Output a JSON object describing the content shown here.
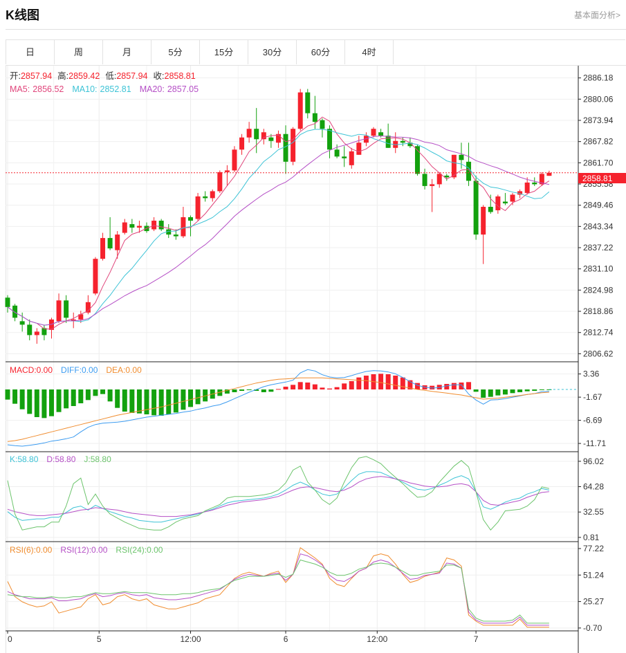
{
  "header": {
    "title": "K线图",
    "link": "基本面分析>"
  },
  "tabs": [
    "日",
    "周",
    "月",
    "5分",
    "15分",
    "30分",
    "60分",
    "4时"
  ],
  "ohlc": {
    "open_label": "开:",
    "open": "2857.94",
    "high_label": "高:",
    "high": "2859.42",
    "low_label": "低:",
    "low": "2857.94",
    "close_label": "收:",
    "close": "2858.81"
  },
  "ma": {
    "ma5_label": "MA5:",
    "ma5": "2856.52",
    "ma10_label": "MA10:",
    "ma10": "2852.81",
    "ma20_label": "MA20:",
    "ma20": "2857.05"
  },
  "macd_legend": {
    "macd": "MACD:0.00",
    "diff": "DIFF:0.00",
    "dea": "DEA:0.00"
  },
  "kdj_legend": {
    "k": "K:58.80",
    "d": "D:58.80",
    "j": "J:58.80"
  },
  "rsi_legend": {
    "r6": "RSI(6):0.00",
    "r12": "RSI(12):0.00",
    "r24": "RSI(24):0.00"
  },
  "current_price": "2858.81",
  "colors": {
    "up": "#f5222d",
    "down": "#13a10e",
    "ma5": "#e0457b",
    "ma10": "#3dc3d6",
    "ma20": "#b54fc6",
    "diff": "#3b9bf0",
    "dea": "#f08c2e",
    "rsi6": "#f08c2e",
    "rsi12": "#b54fc6",
    "rsi24": "#6cc46c"
  },
  "chart_data": {
    "type": "candlestick",
    "x_tick_labels": [
      "0",
      "5",
      "12:00",
      "6",
      "12:00",
      "7"
    ],
    "main_axis": {
      "ticks": [
        "2886.18",
        "2880.06",
        "2873.94",
        "2867.82",
        "2861.70",
        "2855.58",
        "2849.46",
        "2843.34",
        "2837.22",
        "2831.10",
        "2824.98",
        "2818.86",
        "2812.74",
        "2806.62"
      ],
      "range": [
        2804.3,
        2889.7
      ]
    },
    "macd_axis": {
      "ticks": [
        "3.36",
        "-1.67",
        "-6.69",
        "-11.71"
      ],
      "range": [
        -13.5,
        6.0
      ]
    },
    "kdj_axis": {
      "ticks": [
        "96.02",
        "64.28",
        "32.55",
        "0.81"
      ],
      "range": [
        -4.5,
        108.0
      ]
    },
    "rsi_axis": {
      "ticks": [
        "77.22",
        "51.24",
        "25.27",
        "-0.70"
      ],
      "range": [
        -3.5,
        84.0
      ]
    },
    "candles": [
      [
        2822.8,
        2823.5,
        2818.5,
        2820.1
      ],
      [
        2820.5,
        2821.0,
        2816.0,
        2817.0
      ],
      [
        2816.0,
        2818.5,
        2813.0,
        2815.0
      ],
      [
        2815.0,
        2816.5,
        2810.5,
        2812.0
      ],
      [
        2812.0,
        2814.0,
        2809.5,
        2813.0
      ],
      [
        2814.0,
        2815.0,
        2810.5,
        2812.0
      ],
      [
        2813.5,
        2817.0,
        2811.0,
        2816.5
      ],
      [
        2816.0,
        2824.0,
        2815.5,
        2822.0
      ],
      [
        2822.0,
        2823.5,
        2815.5,
        2817.0
      ],
      [
        2816.0,
        2818.5,
        2814.0,
        2816.5
      ],
      [
        2816.5,
        2819.0,
        2815.5,
        2818.0
      ],
      [
        2818.5,
        2823.5,
        2818.0,
        2821.5
      ],
      [
        2824.0,
        2834.5,
        2823.5,
        2834.0
      ],
      [
        2834.0,
        2841.5,
        2833.5,
        2840.0
      ],
      [
        2840.0,
        2846.0,
        2836.5,
        2837.0
      ],
      [
        2836.5,
        2842.0,
        2834.0,
        2841.0
      ],
      [
        2841.5,
        2845.5,
        2841.0,
        2844.5
      ],
      [
        2844.0,
        2845.5,
        2841.5,
        2843.0
      ],
      [
        2843.0,
        2845.0,
        2841.5,
        2843.5
      ],
      [
        2843.5,
        2844.5,
        2841.5,
        2842.0
      ],
      [
        2842.5,
        2846.0,
        2842.0,
        2845.0
      ],
      [
        2845.0,
        2845.5,
        2842.0,
        2842.5
      ],
      [
        2842.5,
        2844.0,
        2840.0,
        2841.0
      ],
      [
        2841.0,
        2842.5,
        2839.5,
        2840.5
      ],
      [
        2840.5,
        2849.0,
        2840.0,
        2846.0
      ],
      [
        2846.0,
        2846.5,
        2840.5,
        2845.0
      ],
      [
        2845.5,
        2853.0,
        2845.0,
        2852.0
      ],
      [
        2852.0,
        2853.5,
        2850.5,
        2851.5
      ],
      [
        2851.5,
        2854.0,
        2850.5,
        2853.5
      ],
      [
        2853.5,
        2859.5,
        2853.0,
        2859.0
      ],
      [
        2859.0,
        2861.0,
        2855.0,
        2859.5
      ],
      [
        2859.5,
        2866.5,
        2859.0,
        2865.5
      ],
      [
        2865.5,
        2870.0,
        2864.0,
        2869.0
      ],
      [
        2869.0,
        2873.5,
        2867.5,
        2871.5
      ],
      [
        2871.5,
        2877.5,
        2864.5,
        2868.5
      ],
      [
        2868.5,
        2871.5,
        2867.0,
        2870.5
      ],
      [
        2869.0,
        2870.0,
        2866.0,
        2868.0
      ],
      [
        2867.5,
        2871.0,
        2866.0,
        2870.0
      ],
      [
        2870.0,
        2872.5,
        2858.5,
        2862.0
      ],
      [
        2862.0,
        2872.0,
        2861.0,
        2871.5
      ],
      [
        2871.5,
        2883.0,
        2871.0,
        2882.0
      ],
      [
        2882.0,
        2883.0,
        2874.5,
        2876.0
      ],
      [
        2876.0,
        2881.0,
        2871.5,
        2873.5
      ],
      [
        2874.0,
        2874.5,
        2869.0,
        2871.5
      ],
      [
        2871.5,
        2872.5,
        2863.0,
        2865.5
      ],
      [
        2865.5,
        2867.0,
        2863.0,
        2863.5
      ],
      [
        2863.5,
        2866.5,
        2860.5,
        2863.0
      ],
      [
        2861.0,
        2866.0,
        2860.0,
        2865.0
      ],
      [
        2864.0,
        2869.5,
        2864.0,
        2867.5
      ],
      [
        2867.5,
        2870.5,
        2866.5,
        2869.5
      ],
      [
        2869.5,
        2872.0,
        2869.0,
        2871.5
      ],
      [
        2870.5,
        2871.5,
        2869.0,
        2869.5
      ],
      [
        2869.5,
        2873.0,
        2866.0,
        2866.0
      ],
      [
        2866.0,
        2870.5,
        2864.5,
        2868.0
      ],
      [
        2868.0,
        2869.0,
        2866.5,
        2867.5
      ],
      [
        2867.5,
        2869.0,
        2866.0,
        2866.5
      ],
      [
        2866.5,
        2867.0,
        2858.0,
        2858.5
      ],
      [
        2858.5,
        2860.0,
        2854.0,
        2855.0
      ],
      [
        2855.0,
        2857.0,
        2847.5,
        2855.5
      ],
      [
        2855.5,
        2859.0,
        2854.5,
        2858.5
      ],
      [
        2858.0,
        2858.5,
        2856.5,
        2857.5
      ],
      [
        2857.5,
        2864.0,
        2857.0,
        2864.0
      ],
      [
        2864.0,
        2867.5,
        2860.0,
        2862.5
      ],
      [
        2862.0,
        2867.5,
        2855.0,
        2856.5
      ],
      [
        2856.5,
        2858.0,
        2839.5,
        2841.0
      ],
      [
        2841.0,
        2849.5,
        2832.5,
        2849.0
      ],
      [
        2849.0,
        2852.5,
        2847.0,
        2847.5
      ],
      [
        2848.0,
        2852.5,
        2847.0,
        2852.0
      ],
      [
        2850.5,
        2853.0,
        2849.5,
        2850.0
      ],
      [
        2850.5,
        2853.0,
        2849.5,
        2852.5
      ],
      [
        2852.5,
        2854.0,
        2851.5,
        2853.5
      ],
      [
        2853.0,
        2857.5,
        2852.5,
        2856.0
      ],
      [
        2856.0,
        2857.5,
        2855.0,
        2855.5
      ],
      [
        2855.5,
        2859.0,
        2855.0,
        2858.5
      ],
      [
        2857.94,
        2859.42,
        2857.94,
        2858.81
      ]
    ],
    "macd": [
      -2.2,
      -3.1,
      -4.3,
      -5.3,
      -6.0,
      -6.2,
      -5.8,
      -4.9,
      -4.1,
      -3.6,
      -3.0,
      -2.3,
      -1.4,
      -1.0,
      -2.6,
      -4.0,
      -4.8,
      -5.1,
      -5.2,
      -5.4,
      -5.6,
      -5.7,
      -5.4,
      -5.0,
      -4.4,
      -3.8,
      -3.2,
      -2.6,
      -2.0,
      -1.4,
      -0.9,
      -0.6,
      -0.3,
      -0.1,
      -0.3,
      -0.6,
      -0.5,
      0.1,
      0.6,
      1.0,
      1.6,
      1.5,
      1.1,
      0.4,
      0.2,
      0.5,
      1.3,
      1.8,
      2.6,
      3.0,
      3.3,
      3.4,
      3.3,
      3.0,
      2.6,
      2.0,
      1.4,
      0.9,
      0.8,
      1.0,
      1.2,
      1.4,
      1.5,
      1.6,
      -0.5,
      -1.8,
      -1.6,
      -1.3,
      -1.1,
      -0.8,
      -0.6,
      -0.4,
      -0.3,
      -0.1,
      -0.1
    ],
    "diff": [
      -12.0,
      -12.2,
      -12.3,
      -12.1,
      -11.9,
      -11.6,
      -11.2,
      -11.0,
      -10.7,
      -10.3,
      -9.2,
      -8.2,
      -7.6,
      -7.3,
      -7.2,
      -7.1,
      -6.9,
      -6.6,
      -6.3,
      -6.0,
      -5.8,
      -5.6,
      -5.4,
      -5.2,
      -4.9,
      -4.7,
      -4.3,
      -4.0,
      -3.6,
      -3.3,
      -2.7,
      -2.0,
      -1.3,
      -0.6,
      0.0,
      0.6,
      1.0,
      1.3,
      1.6,
      2.0,
      3.6,
      4.3,
      4.0,
      3.2,
      2.7,
      2.5,
      2.6,
      3.0,
      3.5,
      3.9,
      4.1,
      4.0,
      3.8,
      3.4,
      2.6,
      1.7,
      0.9,
      0.5,
      0.3,
      0.4,
      0.8,
      1.0,
      1.0,
      -1.0,
      -2.3,
      -3.2,
      -2.3,
      -2.2,
      -2.0,
      -1.7,
      -1.4,
      -1.1,
      -0.9,
      -0.5,
      -0.4
    ],
    "dea": [
      -11.3,
      -11.1,
      -10.8,
      -10.4,
      -10.0,
      -9.6,
      -9.2,
      -8.8,
      -8.4,
      -8.0,
      -7.6,
      -7.2,
      -6.8,
      -6.4,
      -6.0,
      -5.6,
      -5.3,
      -5.0,
      -4.7,
      -4.4,
      -4.1,
      -3.8,
      -3.4,
      -3.0,
      -2.6,
      -2.2,
      -1.8,
      -1.4,
      -1.0,
      -0.6,
      -0.2,
      0.2,
      0.6,
      1.0,
      1.4,
      1.7,
      2.0,
      2.2,
      2.3,
      2.4,
      2.5,
      2.5,
      2.5,
      2.5,
      2.4,
      2.3,
      2.2,
      2.1,
      2.0,
      1.9,
      1.7,
      1.5,
      1.2,
      0.9,
      0.6,
      0.3,
      0.0,
      -0.2,
      -0.4,
      -0.6,
      -0.8,
      -1.0,
      -1.2,
      -1.5,
      -1.8,
      -2.1,
      -2.0,
      -1.9,
      -1.7,
      -1.5,
      -1.3,
      -1.1,
      -0.9,
      -0.7,
      -0.6
    ],
    "kdj_k": [
      33,
      26,
      22,
      23,
      24,
      24,
      26,
      26,
      32,
      38,
      40,
      35,
      41,
      37,
      33,
      30,
      27,
      25,
      22,
      21,
      20,
      20,
      22,
      24,
      26,
      28,
      30,
      33,
      36,
      40,
      44,
      46,
      47,
      48,
      49,
      50,
      52,
      55,
      60,
      66,
      70,
      66,
      60,
      55,
      53,
      55,
      63,
      72,
      80,
      83,
      83,
      82,
      78,
      74,
      70,
      65,
      61,
      60,
      62,
      66,
      70,
      75,
      78,
      74,
      58,
      39,
      36,
      40,
      45,
      48,
      50,
      55,
      58,
      62,
      60
    ],
    "kdj_d": [
      36,
      33,
      31,
      29,
      28,
      28,
      29,
      30,
      31,
      33,
      35,
      36,
      38,
      37,
      36,
      35,
      33,
      31,
      30,
      29,
      28,
      27,
      27,
      27,
      28,
      29,
      31,
      33,
      35,
      38,
      41,
      43,
      45,
      46,
      47,
      48,
      50,
      52,
      56,
      60,
      63,
      64,
      63,
      61,
      59,
      58,
      60,
      64,
      70,
      74,
      76,
      77,
      76,
      74,
      72,
      69,
      67,
      65,
      64,
      64,
      65,
      67,
      68,
      66,
      58,
      47,
      42,
      41,
      43,
      45,
      47,
      51,
      54,
      57,
      58
    ],
    "kdj_j": [
      72,
      30,
      10,
      12,
      14,
      14,
      20,
      20,
      40,
      68,
      75,
      42,
      55,
      40,
      30,
      25,
      20,
      16,
      12,
      11,
      10,
      10,
      14,
      20,
      24,
      26,
      28,
      34,
      38,
      42,
      50,
      52,
      52,
      52,
      53,
      54,
      56,
      60,
      69,
      85,
      90,
      70,
      60,
      48,
      42,
      50,
      70,
      88,
      100,
      102,
      98,
      93,
      84,
      76,
      68,
      59,
      51,
      52,
      58,
      70,
      80,
      90,
      97,
      89,
      58,
      23,
      10,
      20,
      34,
      35,
      36,
      40,
      48,
      64,
      62
    ],
    "rsi6": [
      45,
      30,
      25,
      22,
      20,
      21,
      25,
      14,
      16,
      18,
      20,
      28,
      32,
      22,
      24,
      30,
      32,
      28,
      26,
      28,
      22,
      20,
      18,
      18,
      20,
      22,
      24,
      28,
      30,
      32,
      40,
      48,
      52,
      54,
      52,
      50,
      53,
      55,
      44,
      52,
      78,
      73,
      68,
      62,
      48,
      42,
      40,
      48,
      55,
      58,
      70,
      72,
      70,
      62,
      52,
      44,
      46,
      50,
      52,
      54,
      68,
      66,
      60,
      12,
      6,
      2,
      2,
      2,
      2,
      2,
      8,
      0,
      0,
      0,
      0
    ],
    "rsi12": [
      35,
      32,
      30,
      28,
      28,
      28,
      29,
      26,
      26,
      27,
      28,
      31,
      33,
      30,
      31,
      33,
      34,
      32,
      31,
      32,
      29,
      28,
      27,
      27,
      28,
      29,
      31,
      33,
      35,
      37,
      42,
      47,
      50,
      52,
      51,
      50,
      52,
      53,
      46,
      52,
      72,
      70,
      66,
      61,
      51,
      46,
      45,
      49,
      55,
      58,
      64,
      66,
      64,
      59,
      53,
      47,
      48,
      51,
      52,
      53,
      63,
      62,
      58,
      15,
      7,
      4,
      4,
      4,
      4,
      5,
      10,
      2,
      2,
      2,
      2
    ],
    "rsi24": [
      32,
      31,
      30,
      30,
      29,
      29,
      30,
      29,
      29,
      30,
      30,
      32,
      34,
      33,
      33,
      34,
      35,
      34,
      34,
      34,
      33,
      32,
      32,
      32,
      33,
      33,
      34,
      36,
      37,
      38,
      42,
      46,
      48,
      50,
      50,
      50,
      51,
      52,
      49,
      52,
      66,
      64,
      62,
      59,
      54,
      51,
      51,
      53,
      57,
      59,
      62,
      63,
      62,
      59,
      55,
      51,
      51,
      53,
      54,
      55,
      61,
      61,
      58,
      18,
      9,
      6,
      6,
      6,
      6,
      7,
      12,
      4,
      4,
      4,
      4
    ]
  }
}
